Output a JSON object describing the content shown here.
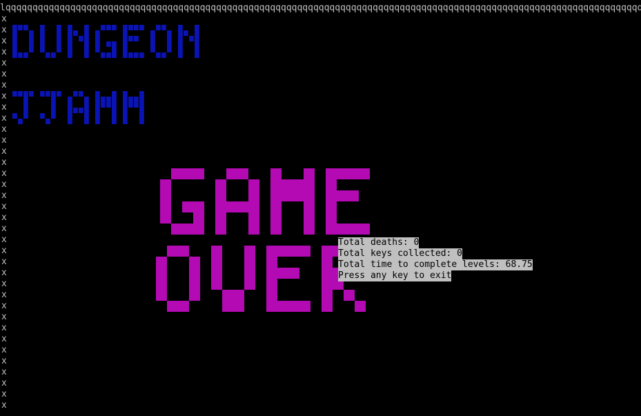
{
  "border": {
    "top_corner": "l",
    "top_fill": "q",
    "left_char": "x"
  },
  "title": {
    "line1": "DUNGEON",
    "line2": "JJAMM",
    "color": "#0a14b4"
  },
  "game_over": {
    "line1": "GAME",
    "line2": "OVER",
    "color": "#b40ab4"
  },
  "stats": {
    "deaths": "Total deaths: 0",
    "keys": "Total keys collected: 0",
    "time": "Total time to complete levels: 68.75",
    "prompt": "Press any key to exit"
  },
  "colors": {
    "background": "#000000",
    "border": "#c0c0c0",
    "stat_bg": "#c0c0c0",
    "stat_fg": "#000000"
  }
}
